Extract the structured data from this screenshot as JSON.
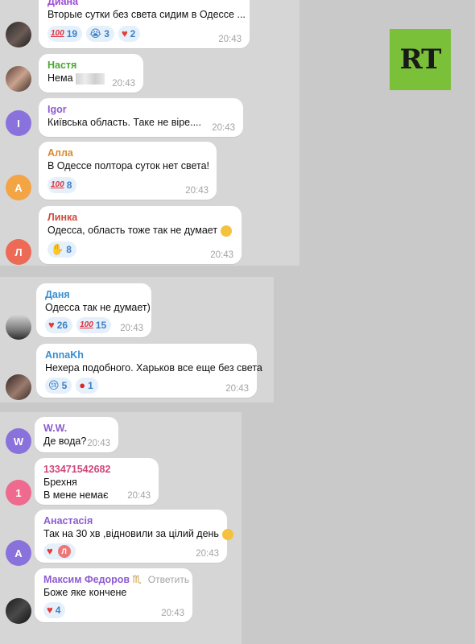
{
  "logo": {
    "text": "RT",
    "color": "#7ac038"
  },
  "messages": [
    {
      "name": "Диана",
      "name_color": "#9c4bd6",
      "text": "Вторые сутки без света сидим в Одессе ...",
      "time": "20:43",
      "avatar": {
        "type": "photo"
      },
      "reactions": [
        {
          "emoji": "100-icon",
          "count": "19"
        },
        {
          "emoji": "crying-face-icon",
          "count": "3"
        },
        {
          "emoji": "heart-icon",
          "count": "2"
        }
      ]
    },
    {
      "name": "Настя",
      "name_color": "#4aa832",
      "text": "Нема",
      "time": "20:43",
      "avatar": {
        "type": "photo"
      }
    },
    {
      "name": "Igor",
      "name_color": "#8e5bd0",
      "text": "Київська область. Таке не віре....",
      "time": "20:43",
      "avatar": {
        "type": "letter",
        "letter": "I",
        "color": "#8a72dc"
      }
    },
    {
      "name": "Алла",
      "name_color": "#d98a2b",
      "text": "В Одессе полтора суток нет света!",
      "time": "20:43",
      "avatar": {
        "type": "letter",
        "letter": "А",
        "color": "#f3a445"
      },
      "reactions": [
        {
          "emoji": "100-icon",
          "count": "8"
        }
      ]
    },
    {
      "name": "Линка",
      "name_color": "#d24a3c",
      "text": "Одесса, область тоже так не думает",
      "time": "20:43",
      "avatar": {
        "type": "letter",
        "letter": "Л",
        "color": "#ec6a56"
      },
      "reactions": [
        {
          "emoji": "clapping-hands-icon",
          "count": "8"
        }
      ]
    },
    {
      "name": "Даня",
      "name_color": "#3a8ed0",
      "text": "Одесса так не думает)",
      "time": "20:43",
      "avatar": {
        "type": "photo"
      },
      "reactions": [
        {
          "emoji": "heart-icon",
          "count": "26"
        },
        {
          "emoji": "100-icon",
          "count": "15"
        }
      ]
    },
    {
      "name": "AnnaKh",
      "name_color": "#3a8ed0",
      "text": "Нехера подобного. Харьков все еще без света",
      "time": "20:43",
      "avatar": {
        "type": "photo"
      },
      "reactions": [
        {
          "emoji": "crying-face-icon",
          "count": "5"
        },
        {
          "emoji": "strawberry-icon",
          "count": "1"
        }
      ]
    },
    {
      "name": "W.W.",
      "name_color": "#8e5bd0",
      "text": "Де вода?",
      "time": "20:43",
      "avatar": {
        "type": "letter",
        "letter": "W",
        "color": "#8a72dc"
      }
    },
    {
      "name": "133471542682",
      "name_color": "#d0467a",
      "text": "Брехня",
      "text2": "В мене немає",
      "time": "20:43",
      "avatar": {
        "type": "letter",
        "letter": "1",
        "color": "#ee6a8e"
      }
    },
    {
      "name": "Анастасія",
      "name_color": "#8e5bd0",
      "text": "Так на 30 хв ,відновили за цілий день",
      "time": "20:43",
      "avatar": {
        "type": "letter",
        "letter": "А",
        "color": "#8a72dc"
      },
      "reactions": [
        {
          "emoji": "heart-icon",
          "mini_avatar": "Л"
        }
      ]
    },
    {
      "name": "Максим Федоров",
      "name_color": "#8e5bd0",
      "reply_label": "Ответить",
      "text": "Боже яке кончене",
      "time": "20:43",
      "avatar": {
        "type": "photo"
      },
      "reactions": [
        {
          "emoji": "heart-icon",
          "count": "4"
        }
      ]
    }
  ]
}
